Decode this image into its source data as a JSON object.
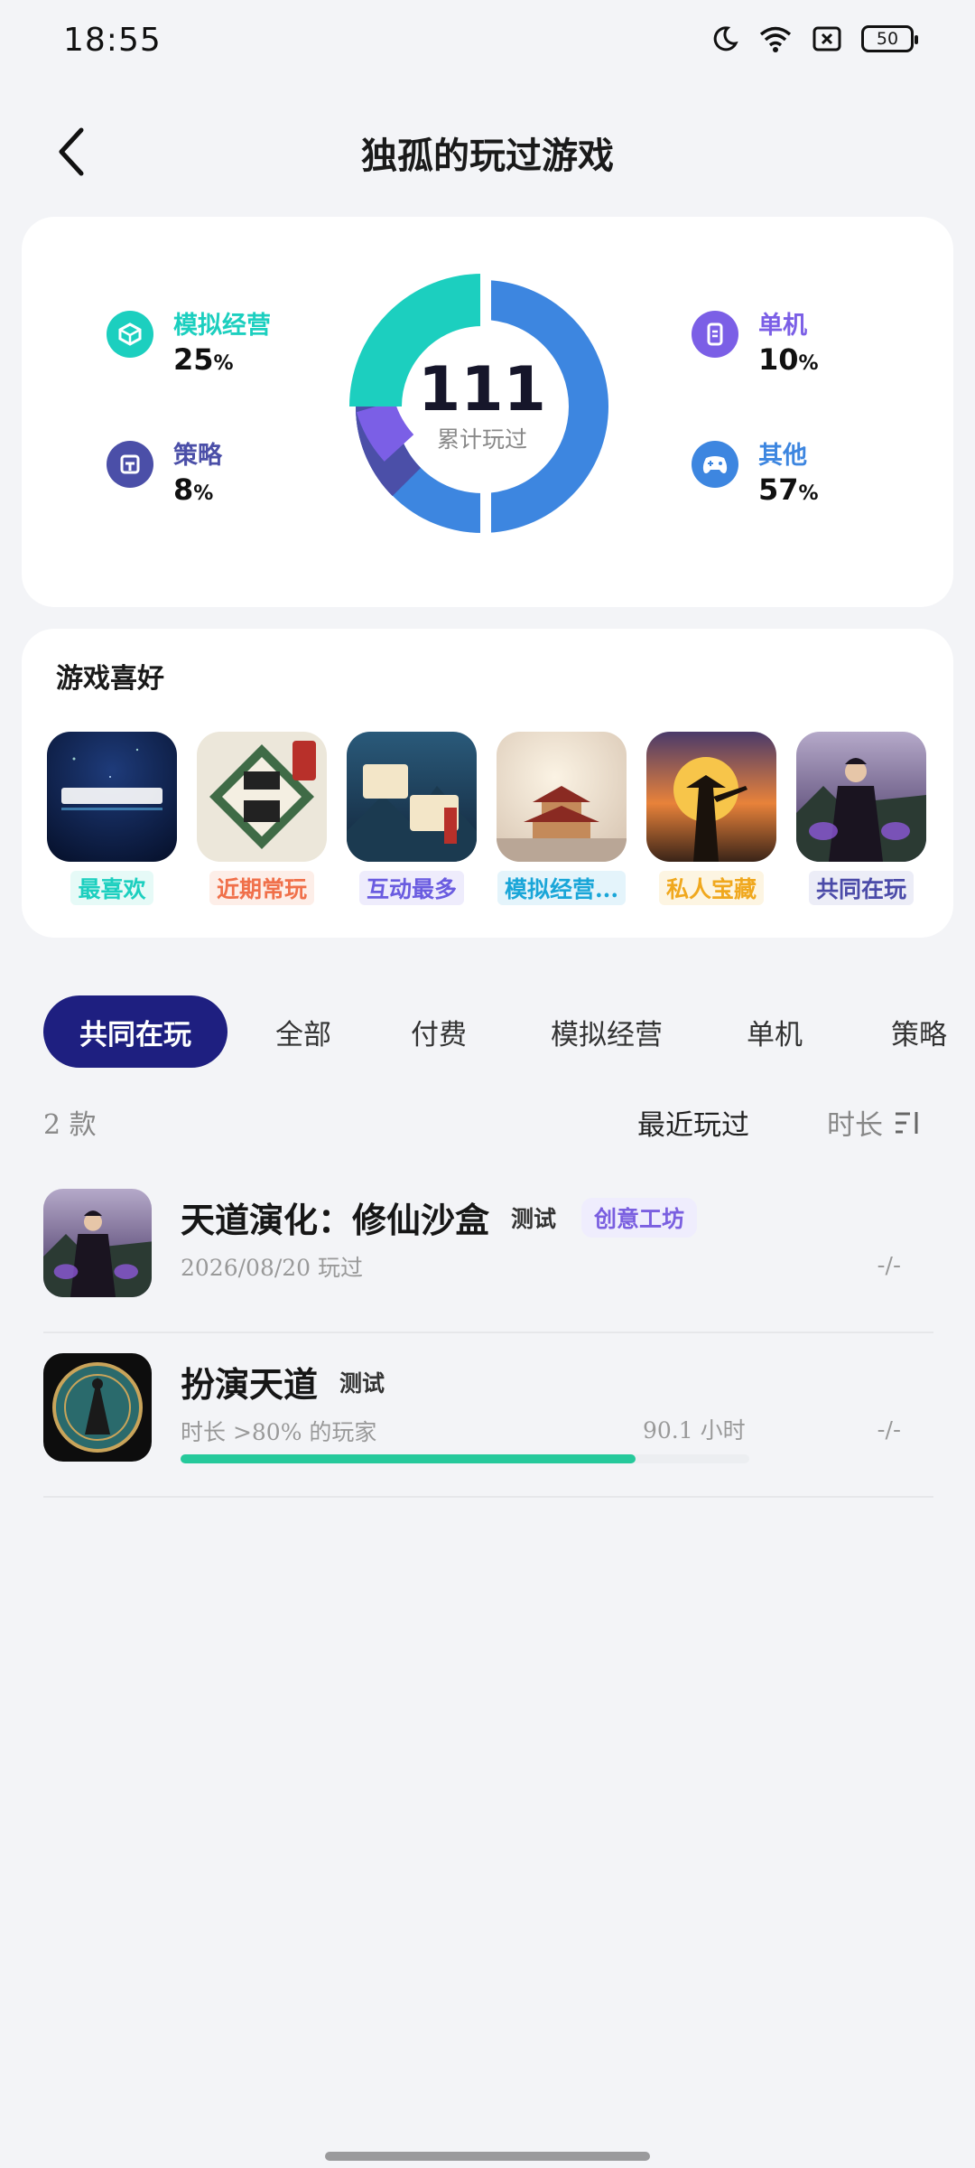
{
  "status": {
    "time": "18:55",
    "battery": "50"
  },
  "header": {
    "title": "独孤的玩过游戏"
  },
  "stats": {
    "total": "111",
    "total_label": "累计玩过",
    "categories": [
      {
        "name": "模拟经营",
        "pct": "25",
        "color": "#1ccfbf",
        "icon": "simulation-icon"
      },
      {
        "name": "策略",
        "pct": "8",
        "color": "#4b4fa8",
        "icon": "strategy-icon"
      },
      {
        "name": "单机",
        "pct": "10",
        "color": "#7b5fe6",
        "icon": "standalone-icon"
      },
      {
        "name": "其他",
        "pct": "57",
        "color": "#3d86e0",
        "icon": "gamepad-icon"
      }
    ],
    "pct_unit": "%"
  },
  "preferences": {
    "title": "游戏喜好",
    "games": [
      {
        "tag": "最喜欢",
        "tag_color": "#1ccfbf",
        "tag_bg": "#e6faf7"
      },
      {
        "tag": "近期常玩",
        "tag_color": "#f0704a",
        "tag_bg": "#fdeee8"
      },
      {
        "tag": "互动最多",
        "tag_color": "#6a5ce0",
        "tag_bg": "#eeecfc"
      },
      {
        "tag": "模拟经营...",
        "tag_color": "#1aa6d8",
        "tag_bg": "#e4f4fb"
      },
      {
        "tag": "私人宝藏",
        "tag_color": "#f0a81e",
        "tag_bg": "#fdf5e2"
      },
      {
        "tag": "共同在玩",
        "tag_color": "#4a4aa8",
        "tag_bg": "#ecedf7"
      }
    ]
  },
  "tabs": [
    "共同在玩",
    "全部",
    "付费",
    "模拟经营",
    "单机",
    "策略"
  ],
  "list": {
    "count": "2 款",
    "sort_recent": "最近玩过",
    "sort_duration": "时长",
    "items": [
      {
        "name": "天道演化：修仙沙盒",
        "badge": "测试",
        "badge2": "创意工坊",
        "sub": "2026/08/20 玩过",
        "duration": "-/-"
      },
      {
        "name": "扮演天道",
        "badge": "测试",
        "sub": "时长 >80% 的玩家",
        "hours": "90.1 小时",
        "progress": 0.8,
        "duration": "-/-"
      }
    ]
  }
}
